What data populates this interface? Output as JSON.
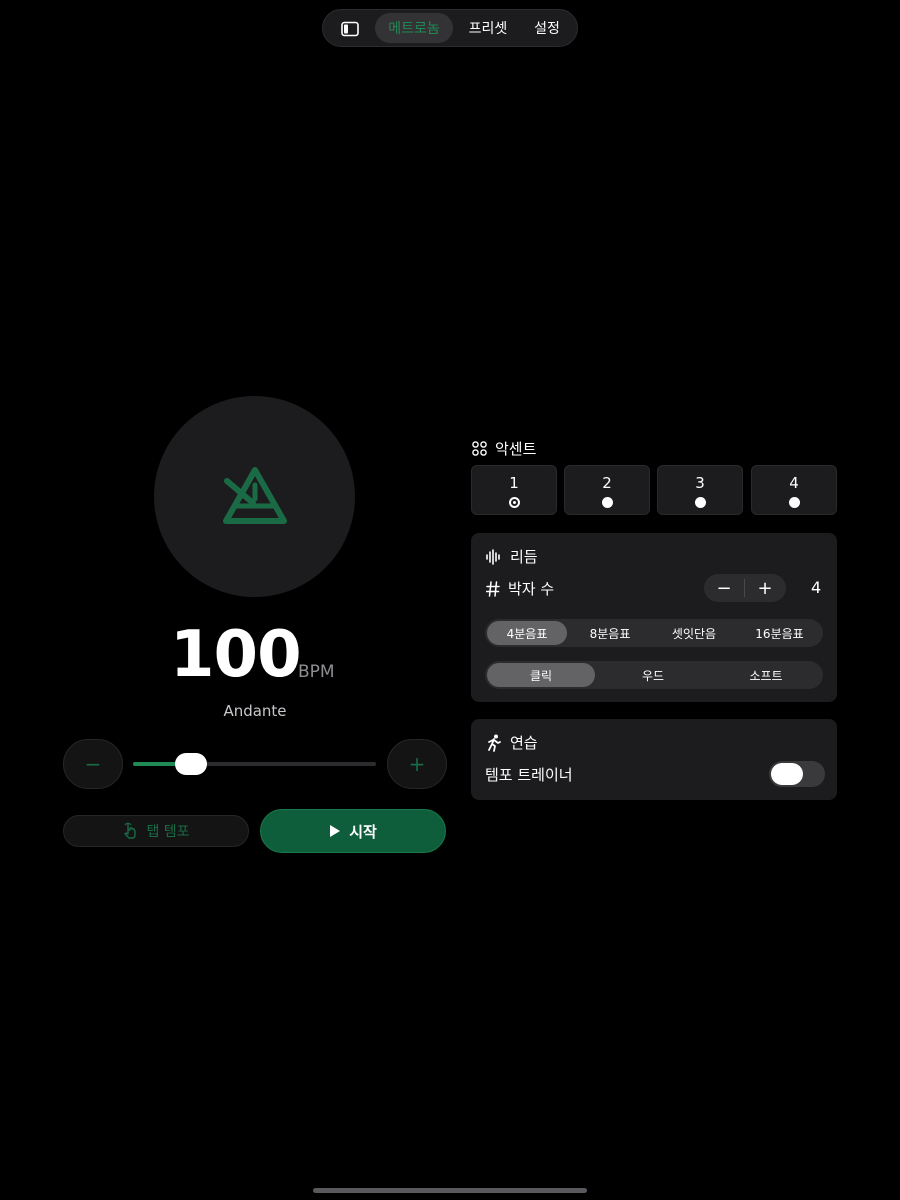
{
  "nav": {
    "tabs": [
      {
        "label": "메트로놈",
        "active": true
      },
      {
        "label": "프리셋",
        "active": false
      },
      {
        "label": "설정",
        "active": false
      }
    ]
  },
  "metronome": {
    "bpm": "100",
    "unit": "BPM",
    "tempo_name": "Andante",
    "decrement_symbol": "−",
    "increment_symbol": "+",
    "slider_fraction": 0.24,
    "tap_label": "탭 템포",
    "start_label": "시작",
    "accent_color": "#1f8a55"
  },
  "accent": {
    "title": "악센트",
    "beats": [
      {
        "number": "1",
        "state": "accent"
      },
      {
        "number": "2",
        "state": "normal"
      },
      {
        "number": "3",
        "state": "normal"
      },
      {
        "number": "4",
        "state": "normal"
      }
    ]
  },
  "rhythm": {
    "title": "리듬",
    "beats_label": "박자 수",
    "beats_value": "4",
    "minus": "−",
    "plus": "+",
    "subdivisions": [
      "4분음표",
      "8분음표",
      "셋잇단음",
      "16분음표"
    ],
    "subdivision_selected": 0,
    "sounds": [
      "클릭",
      "우드",
      "소프트"
    ],
    "sound_selected": 0
  },
  "practice": {
    "title": "연습",
    "trainer_label": "템포 트레이너",
    "trainer_on": false
  }
}
